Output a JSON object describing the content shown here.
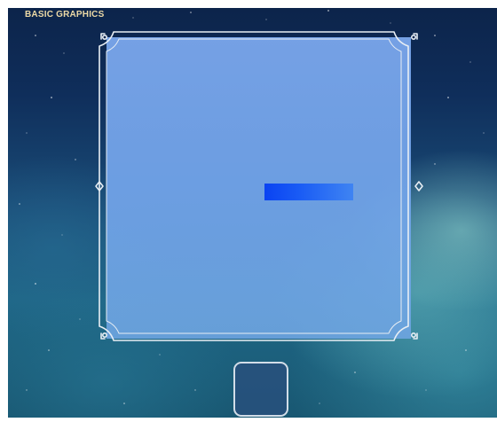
{
  "app": {
    "title": "BASIC GRAPHICS"
  },
  "canvas": {
    "bar_color": "#1453f4",
    "panel_color": "#7eaaf0",
    "frame_color": "#e8eef4"
  },
  "toolbar": {
    "slot_icon": "empty-slot"
  }
}
